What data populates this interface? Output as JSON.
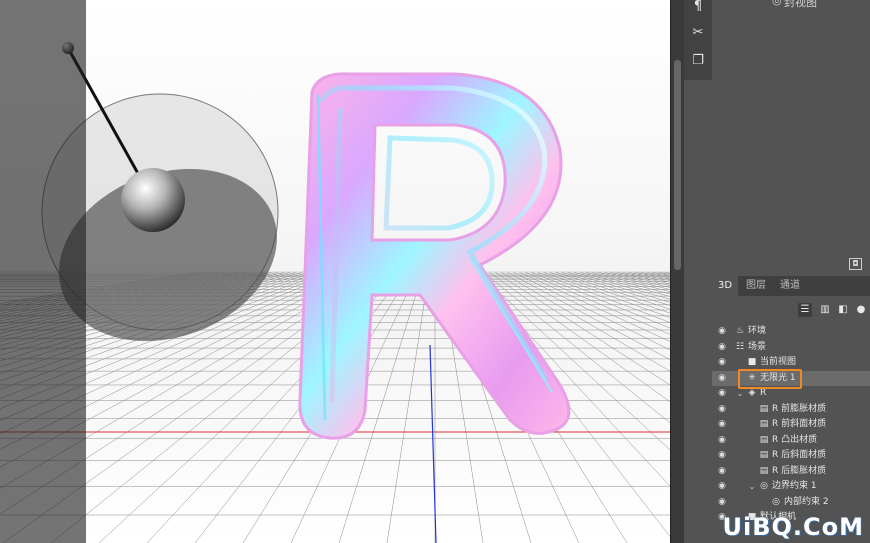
{
  "panel": {
    "doc_label": "封视图",
    "tabs": [
      {
        "label": "3D",
        "active": true
      },
      {
        "label": "图层",
        "active": false
      },
      {
        "label": "通道",
        "active": false
      }
    ],
    "layers": [
      {
        "label": "环境",
        "icon": "environment-icon",
        "depth": 0,
        "twist": ""
      },
      {
        "label": "场景",
        "icon": "scene-icon",
        "depth": 0,
        "twist": ""
      },
      {
        "label": "当前视图",
        "icon": "camera-icon",
        "depth": 1,
        "twist": ""
      },
      {
        "label": "无限光 1",
        "icon": "infinite-light-icon",
        "depth": 1,
        "twist": "",
        "selected": true
      },
      {
        "label": "R",
        "icon": "mesh-icon",
        "depth": 1,
        "twist": "v"
      },
      {
        "label": "R 前膨胀材质",
        "icon": "material-icon",
        "depth": 2,
        "twist": ""
      },
      {
        "label": "R 前斜面材质",
        "icon": "material-icon",
        "depth": 2,
        "twist": ""
      },
      {
        "label": "R 凸出材质",
        "icon": "material-icon",
        "depth": 2,
        "twist": ""
      },
      {
        "label": "R 后斜面材质",
        "icon": "material-icon",
        "depth": 2,
        "twist": ""
      },
      {
        "label": "R 后膨胀材质",
        "icon": "material-icon",
        "depth": 2,
        "twist": ""
      },
      {
        "label": "边界约束 1",
        "icon": "constraint-icon",
        "depth": 2,
        "twist": "v"
      },
      {
        "label": "内部约束 2",
        "icon": "constraint-icon",
        "depth": 3,
        "twist": ""
      },
      {
        "label": "默认相机",
        "icon": "camera-icon",
        "depth": 1,
        "twist": ""
      }
    ]
  },
  "colors": {
    "highlight": "#f08a24",
    "ground_line": "#e03030",
    "axis_line": "#2233dd"
  },
  "watermark": "UiBQ.CoM"
}
